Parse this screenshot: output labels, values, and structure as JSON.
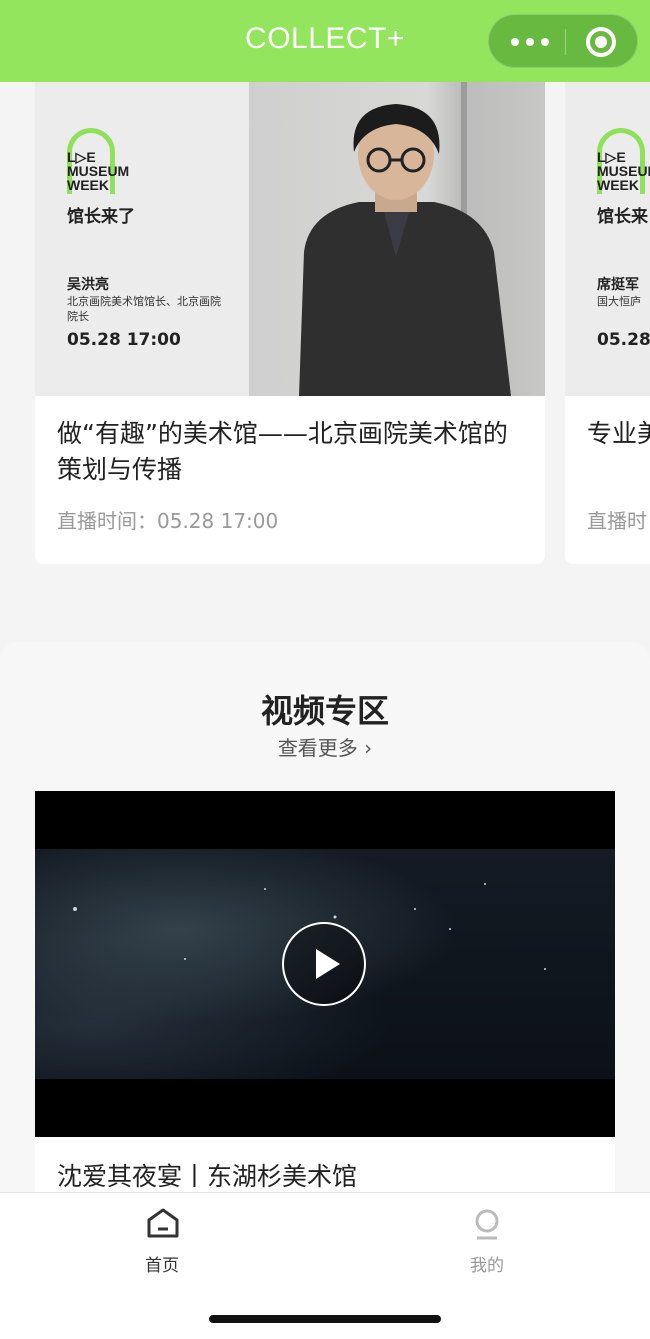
{
  "header": {
    "title": "COLLECT+",
    "more_icon": "more-dots-icon",
    "close_icon": "target-circle-icon",
    "background": "#92e55c"
  },
  "live_cards": [
    {
      "poster": {
        "logo_lines": [
          "L▷E",
          "MUSEUM",
          "WEEK"
        ],
        "brand_cn": "馆长来了",
        "speaker": "吴洪亮",
        "role": "北京画院美术馆馆长、北京画院院长",
        "datetime": "05.28   17:00"
      },
      "title": "做“有趣”的美术馆——北京画院美术馆的策划与传播",
      "time": "直播时间：05.28 17:00"
    },
    {
      "poster": {
        "logo_lines": [
          "L▷E",
          "MUSEUM",
          "WEEK"
        ],
        "brand_cn": "馆长来",
        "speaker": "席挺军",
        "role": "国大恒庐",
        "datetime": "05.28"
      },
      "title": "专业美的跨界",
      "time": "直播时"
    }
  ],
  "video_section": {
    "title": "视频专区",
    "more_label": "查看更多",
    "video_title": "沈爱其夜宴丨东湖杉美术馆"
  },
  "tabbar": {
    "home_label": "首页",
    "mine_label": "我的",
    "active_color": "#333333",
    "inactive_color": "#999999"
  }
}
